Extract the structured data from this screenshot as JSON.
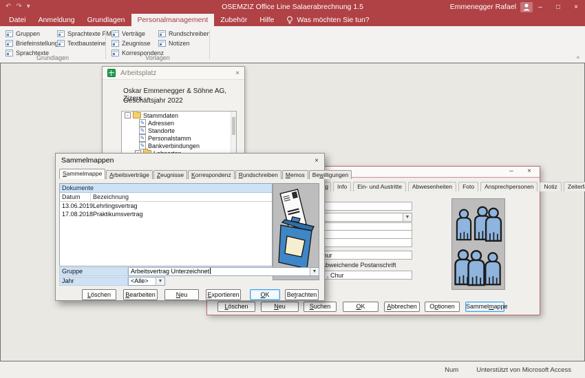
{
  "window": {
    "title": "OSEMZIZ Office Line Salaerabrechnung 1.5",
    "user": "Emmenegger Rafael"
  },
  "ribbon": {
    "tabs": [
      "Datei",
      "Anmeldung",
      "Grundlagen",
      "Personalmanagement",
      "Zubehör",
      "Hilfe"
    ],
    "active_tab": "Personalmanagement",
    "tell_me": "Was möchten Sie tun?",
    "groups": [
      {
        "label": "Grundlagen",
        "columns": [
          [
            "Gruppen",
            "Briefeinstellungen",
            "Sprachtexte"
          ],
          [
            "Sprachtexte PM",
            "Textbausteine"
          ]
        ]
      },
      {
        "label": "Vorlagen",
        "columns": [
          [
            "Verträge",
            "Zeugnisse",
            "Korrespondenz"
          ],
          [
            "Rundschreiben",
            "Notizen"
          ]
        ]
      }
    ]
  },
  "arbeitsplatz": {
    "title": "Arbeitsplatz",
    "company": "Oskar Emmenegger & Söhne AG, Zizers",
    "fiscal_year": "Geschäftsjahr 2022",
    "tree": [
      {
        "label": "Stammdaten",
        "icon": "folder",
        "expander": "-",
        "level": 0
      },
      {
        "label": "Adressen",
        "icon": "form",
        "level": 1
      },
      {
        "label": "Standorte",
        "icon": "form",
        "level": 1
      },
      {
        "label": "Personalstamm",
        "icon": "form",
        "level": 1
      },
      {
        "label": "Bankverbindungen",
        "icon": "form",
        "level": 1
      },
      {
        "label": "Lohnarten",
        "icon": "folder",
        "expander": "+",
        "level": 1
      }
    ]
  },
  "sammelmappen": {
    "title": "Sammelmappen",
    "tabs": [
      {
        "label": "Sammelmappe",
        "u": 0,
        "active": true
      },
      {
        "label": "Arbeitsverträge",
        "u": 0
      },
      {
        "label": "Zeugnisse",
        "u": 0
      },
      {
        "label": "Korrespondenz",
        "u": 0
      },
      {
        "label": "Rundschreiben",
        "u": 0
      },
      {
        "label": "Memos",
        "u": 0
      },
      {
        "label": "Bewilligungen",
        "u": 2
      }
    ],
    "table": {
      "caption": "Dokumente",
      "columns": [
        "Datum",
        "Bezeichnung"
      ],
      "rows": [
        [
          "13.06.2019",
          "Lehrlingsvertrag"
        ],
        [
          "17.08.2018",
          "Praktikumsvertrag"
        ]
      ]
    },
    "fields": [
      {
        "label": "Gruppe",
        "value": "Arbeitsvertrag Unterzeichnet"
      },
      {
        "label": "Jahr",
        "value": "<Alle>"
      }
    ],
    "buttons": [
      {
        "label": "Löschen",
        "u": 0
      },
      {
        "label": "Bearbeiten",
        "u": 0
      },
      {
        "label": "Neu",
        "u": 0
      },
      {
        "label": "Exportieren",
        "u": 0
      },
      {
        "label": "OK",
        "u": 0,
        "default": true
      },
      {
        "label": "Betrachten",
        "u": 2
      }
    ]
  },
  "personal_dialog": {
    "tabs": [
      "ng",
      "Info",
      "Ein- und Austritte",
      "Abwesenheiten",
      "Foto",
      "Ansprechpersonen",
      "Notiz",
      "Zeiterfassung"
    ],
    "field_fragments": {
      "city": "Chur",
      "postal_label": "Abweichende Postanschrift",
      "postal_value": ", Chur"
    },
    "buttons": [
      {
        "label": "Löschen",
        "u": 0
      },
      {
        "label": "Neu",
        "u": 0
      },
      {
        "label": "Suchen",
        "u": 0
      },
      {
        "label": "OK",
        "u": 0
      },
      {
        "label": "Abbrechen",
        "u": 0
      },
      {
        "label": "Optionen",
        "u": 1
      },
      {
        "label": "Sammelmappe",
        "u": 6,
        "focused": true
      }
    ]
  },
  "statusbar": {
    "num": "Num",
    "right": "Unterstützt von Microsoft Access"
  },
  "colors": {
    "accent_red": "#b04145",
    "dialog_border_red": "#bb6b6f",
    "header_blue": "#cfe2f5",
    "people_blue": "#8fb4dd",
    "folder_blue": "#3f86c6"
  }
}
